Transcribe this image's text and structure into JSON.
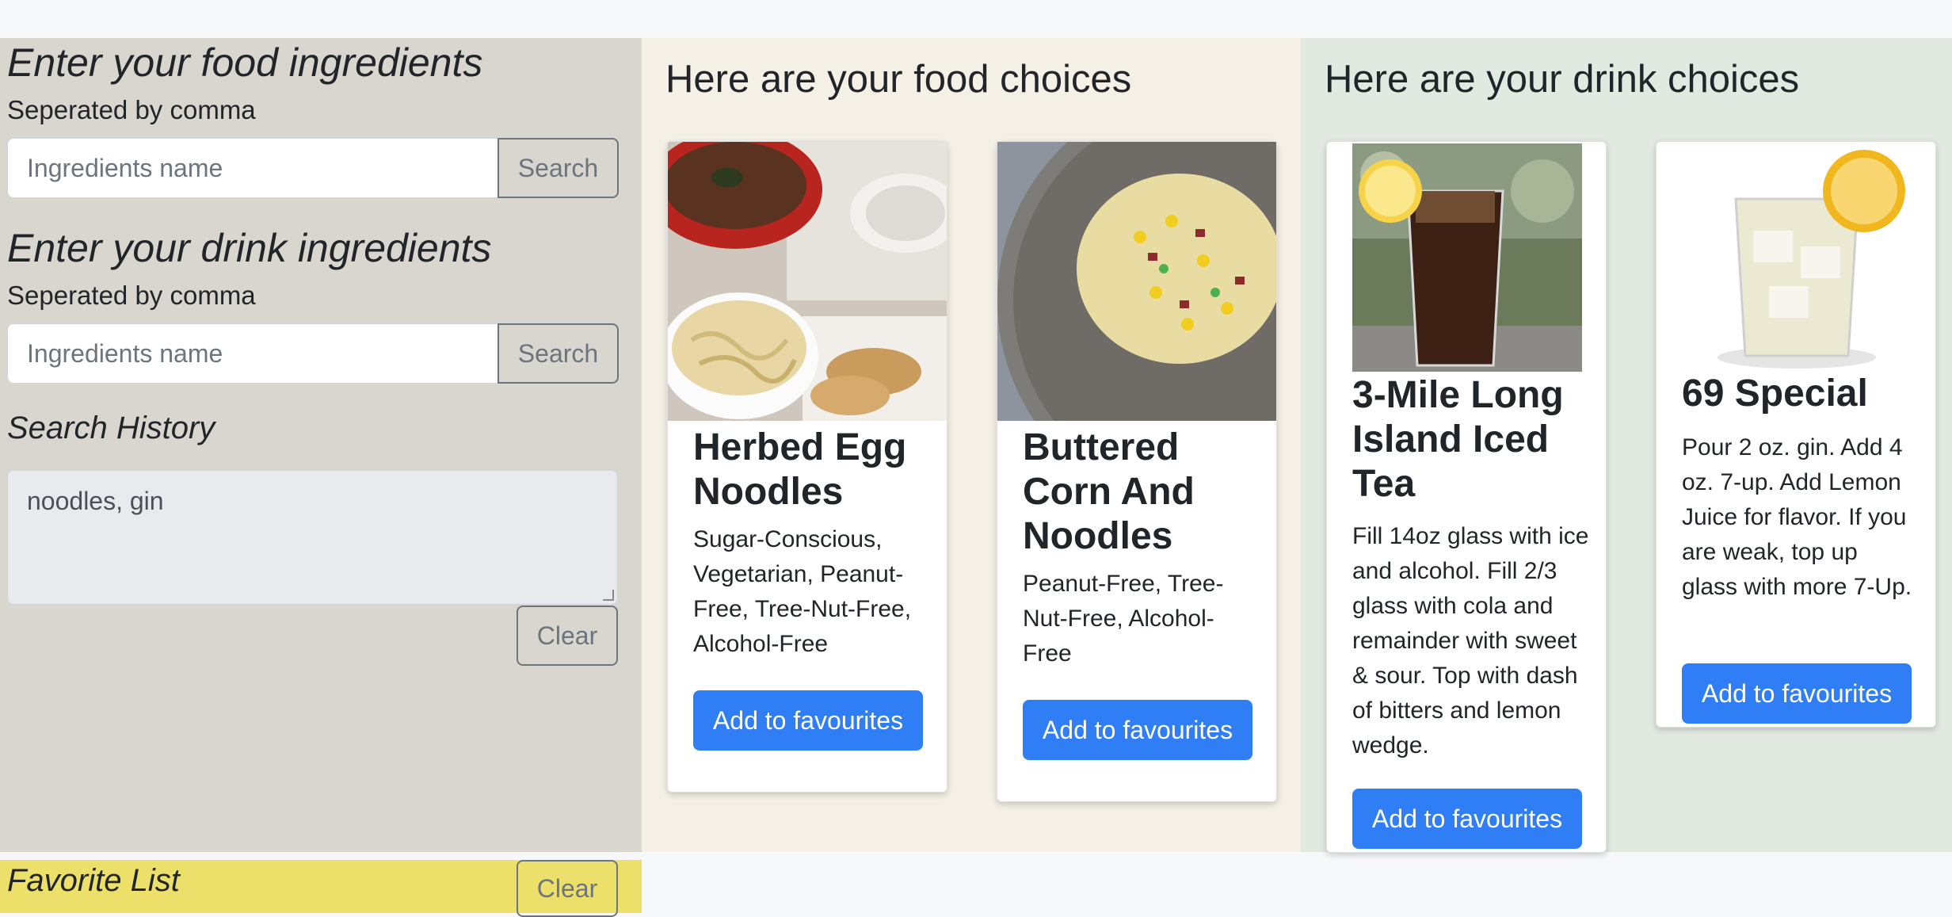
{
  "food_form": {
    "heading": "Enter your food ingredients",
    "hint": "Seperated by comma",
    "placeholder": "Ingredients name",
    "search_label": "Search"
  },
  "drink_form": {
    "heading": "Enter your drink ingredients",
    "hint": "Seperated by comma",
    "placeholder": "Ingredients name",
    "search_label": "Search"
  },
  "history": {
    "heading": "Search History",
    "value": "noodles, gin",
    "clear_label": "Clear"
  },
  "favorites": {
    "heading": "Favorite List",
    "clear_label": "Clear"
  },
  "food": {
    "title": "Here are your food choices",
    "cards": [
      {
        "title": "Herbed Egg Noodles",
        "description": "Sugar-Conscious, Vegetarian, Peanut-Free, Tree-Nut-Free, Alcohol-Free",
        "button": "Add to favourites"
      },
      {
        "title": "Buttered Corn And Noodles",
        "description": "Peanut-Free, Tree-Nut-Free, Alcohol-Free",
        "button": "Add to favourites"
      }
    ]
  },
  "drinks": {
    "title": "Here are your drink choices",
    "cards": [
      {
        "title": "3-Mile Long Island Iced Tea",
        "description": "Fill 14oz glass with ice and alcohol. Fill 2/3 glass with cola and remainder with sweet & sour. Top with dash of bitters and lemon wedge.",
        "button": "Add to favourites"
      },
      {
        "title": "69 Special",
        "description": "Pour 2 oz. gin. Add 4 oz. 7-up. Add Lemon Juice for flavor. If you are weak, top up glass with more 7-Up.",
        "button": "Add to favourites"
      }
    ]
  },
  "colors": {
    "primary": "#2f7ef5",
    "left_panel": "#d9d6d0",
    "food_panel": "#f4f0e6",
    "drink_panel": "#e1e9e1",
    "favorites_panel": "#ede06a"
  }
}
